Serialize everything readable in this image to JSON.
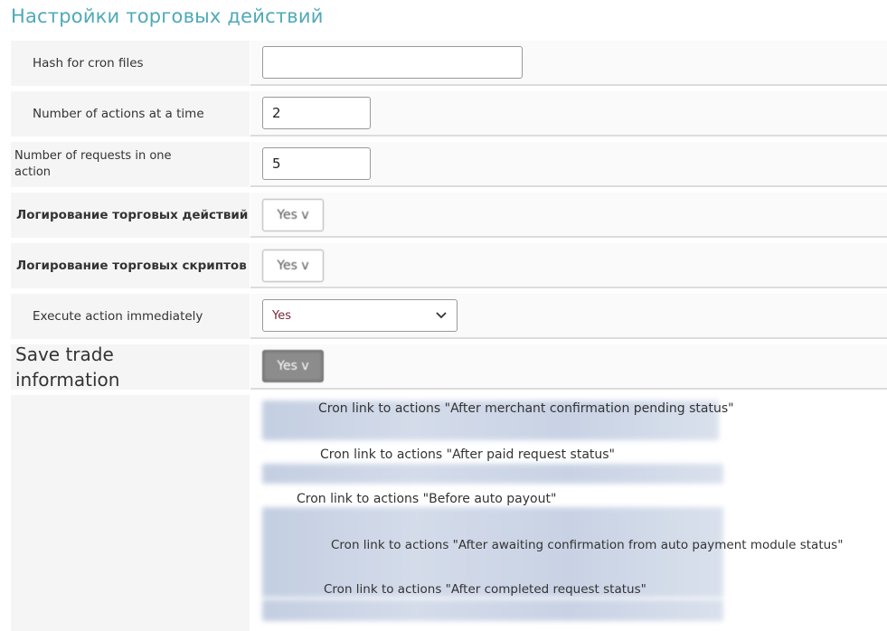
{
  "page": {
    "title": "Настройки торговых действий"
  },
  "settings": {
    "hash": {
      "label": "Hash for cron files",
      "value": ""
    },
    "actions_at_time": {
      "label": "Number of actions at a time",
      "value": "2"
    },
    "requests_per_action": {
      "label": "Number of requests in one action",
      "value": "5"
    },
    "log_actions": {
      "label": "Логирование торговых действий",
      "value": "Yes v"
    },
    "log_scripts": {
      "label": "Логирование торговых скриптов",
      "value": "Yes v"
    },
    "execute_immediately": {
      "label": "Execute action immediately",
      "value": "Yes"
    },
    "save_trade_info": {
      "label": "Save trade information",
      "value": "Yes v"
    }
  },
  "cron_links": [
    {
      "label": "Cron link to actions \"After merchant confirmation pending status\""
    },
    {
      "label": "Cron link to actions \"After paid request status\""
    },
    {
      "label": "Cron link to actions \"Before auto payout\""
    },
    {
      "label": "Cron link to actions \"After awaiting confirmation from auto payment module status\""
    },
    {
      "label": "Cron link to actions \"After completed request status\""
    }
  ],
  "icons": {
    "select_arrow": "chevron-down-icon"
  }
}
